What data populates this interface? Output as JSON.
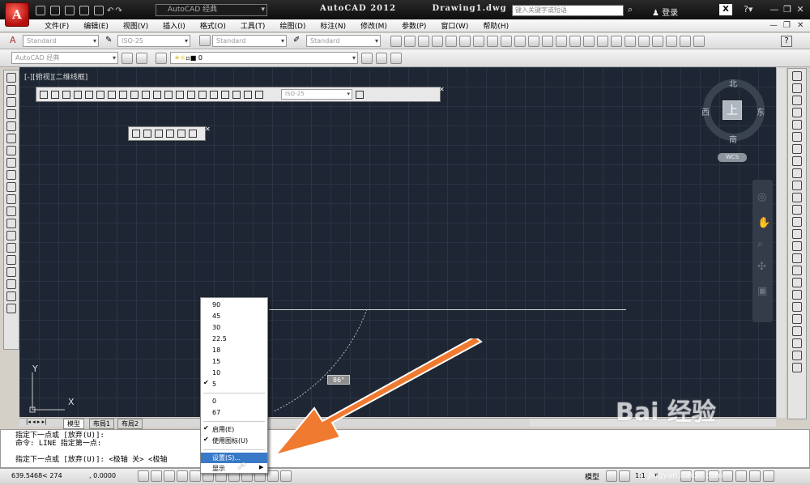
{
  "title_bar": {
    "app_title": "AutoCAD 2012",
    "document": "Drawing1.dwg",
    "workspace": "AutoCAD 经典",
    "search_placeholder": "键入关键字或短语",
    "login": "登录",
    "app_button": "A"
  },
  "menu": [
    "文件(F)",
    "编辑(E)",
    "视图(V)",
    "插入(I)",
    "格式(O)",
    "工具(T)",
    "绘图(D)",
    "标注(N)",
    "修改(M)",
    "参数(P)",
    "窗口(W)",
    "帮助(H)"
  ],
  "styles_toolbar": {
    "text_style": "Standard",
    "dim_style": "ISO-25",
    "table_style": "Standard",
    "mleader_style": "Standard"
  },
  "layers_toolbar": {
    "workspace": "AutoCAD 经典",
    "layer": "0"
  },
  "viewport_label": "[-][俯视][二维线框]",
  "dim_toolbar": {
    "style": "ISO-25"
  },
  "viewcube": {
    "north": "北",
    "south": "南",
    "west": "西",
    "east": "东",
    "face": "上",
    "ucs": "WCS"
  },
  "angle_readout": "86°",
  "ucs_labels": {
    "y": "Y",
    "x": "X"
  },
  "context_menu": {
    "angles": [
      "90",
      "45",
      "30",
      "22.5",
      "18",
      "15",
      "10",
      "5"
    ],
    "checked_angle": "5",
    "extra": [
      "0",
      "67"
    ],
    "options": [
      {
        "label": "启用(E)",
        "checked": true
      },
      {
        "label": "使用图标(U)",
        "checked": true
      }
    ],
    "settings": "设置(S)...",
    "display": "显示"
  },
  "layout_tabs": [
    "模型",
    "布局1",
    "布局2"
  ],
  "command_lines": [
    "指定下一点或 [放弃(U)]:",
    "命令:  LINE 指定第一点:"
  ],
  "command_prompt": "指定下一点或 [放弃(U)]: <极轴 关> <极轴",
  "status": {
    "coords": "639.5468< 274",
    "coord_z": ", 0.0000",
    "model": "模型",
    "scale": "1:1"
  },
  "watermark": {
    "logo": "Bai 经验",
    "url": "jingyan.baidu.com"
  }
}
